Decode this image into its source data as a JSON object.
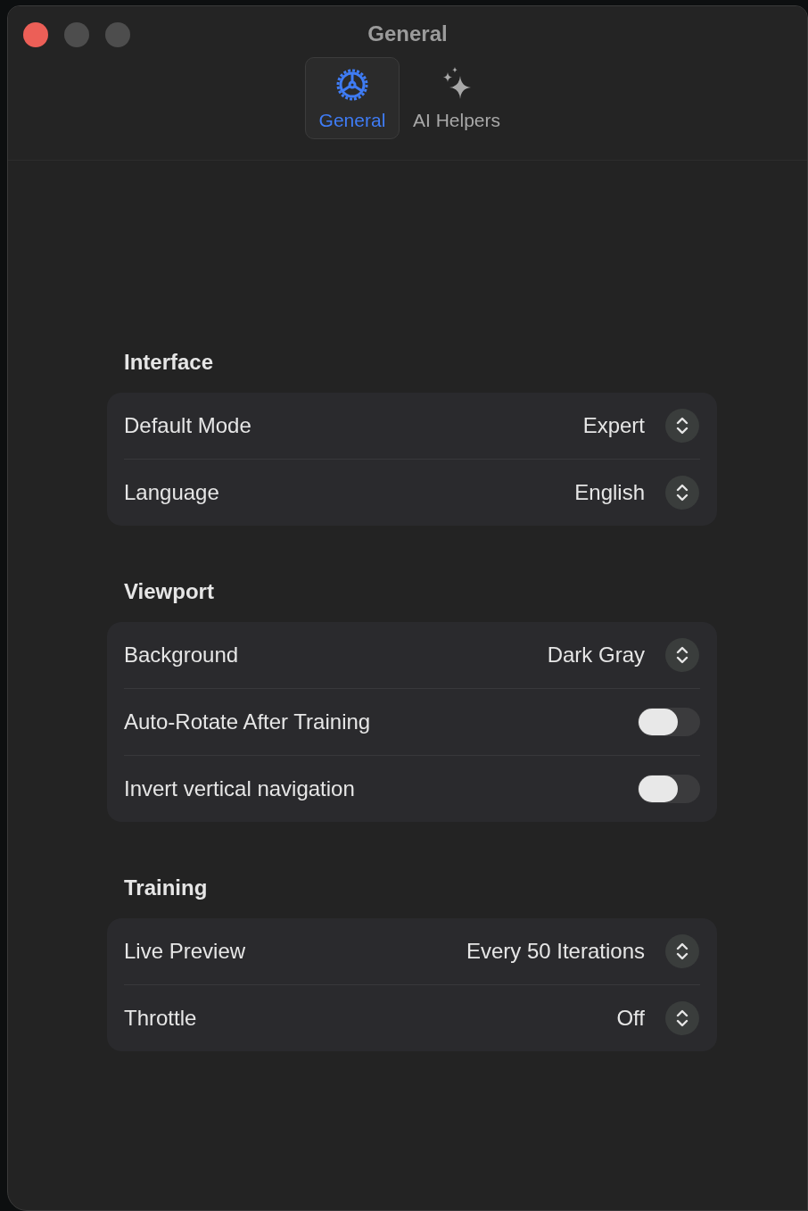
{
  "window": {
    "title": "General"
  },
  "tabs": [
    {
      "label": "General",
      "kind": "gear",
      "selected": true
    },
    {
      "label": "AI Helpers",
      "kind": "sparkles",
      "selected": false
    }
  ],
  "sections": [
    {
      "title": "Interface",
      "rows": [
        {
          "kind": "select",
          "label": "Default Mode",
          "value": "Expert"
        },
        {
          "kind": "select",
          "label": "Language",
          "value": "English"
        }
      ]
    },
    {
      "title": "Viewport",
      "rows": [
        {
          "kind": "select",
          "label": "Background",
          "value": "Dark Gray"
        },
        {
          "kind": "toggle",
          "label": "Auto-Rotate After Training",
          "on": false
        },
        {
          "kind": "toggle",
          "label": "Invert vertical navigation",
          "on": false
        }
      ]
    },
    {
      "title": "Training",
      "rows": [
        {
          "kind": "select",
          "label": "Live Preview",
          "value": "Every 50 Iterations"
        },
        {
          "kind": "select",
          "label": "Throttle",
          "value": "Off"
        }
      ]
    }
  ]
}
